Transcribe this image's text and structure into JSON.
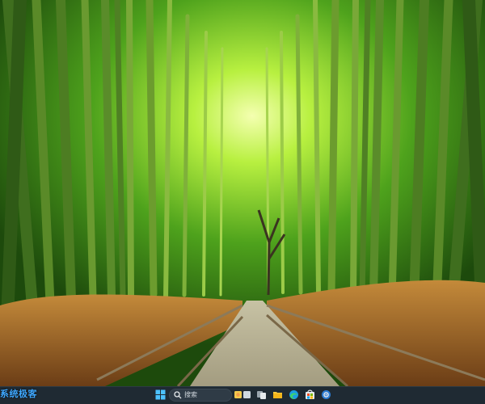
{
  "wallpaper": {
    "description_alt": "bamboo-forest-path"
  },
  "watermark": {
    "text": "系统极客"
  },
  "taskbar": {
    "search": {
      "placeholder": "搜索"
    },
    "pinned_icons": [
      {
        "name": "start-icon"
      },
      {
        "name": "widgets-icon"
      },
      {
        "name": "task-view-icon"
      },
      {
        "name": "file-explorer-icon"
      },
      {
        "name": "edge-browser-icon"
      },
      {
        "name": "microsoft-store-icon"
      },
      {
        "name": "settings-app-icon"
      }
    ],
    "colors": {
      "background": "#1f2a33",
      "accent": "#3fa8ff"
    }
  }
}
